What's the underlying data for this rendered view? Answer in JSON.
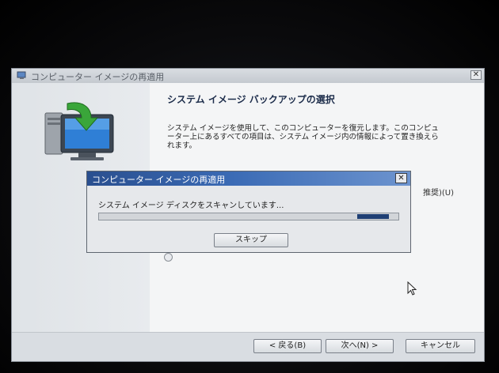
{
  "wizard": {
    "title": "コンピューター イメージの再適用",
    "close_glyph": "✕",
    "heading": "システム イメージ バックアップの選択",
    "description": "システム イメージを使用して、このコンピューターを復元します。このコンピューター上にあるすべての項目は、システム イメージ内の情報によって置き換えられます。",
    "hidden_option_text": "推奨)(U)",
    "buttons": {
      "back": "< 戻る(B)",
      "next": "次へ(N) >",
      "cancel": "キャンセル"
    }
  },
  "dialog": {
    "title": "コンピューター イメージの再適用",
    "close_glyph": "✕",
    "status": "システム イメージ ディスクをスキャンしています...",
    "progress_mode": "marquee",
    "skip_button": "スキップ"
  },
  "colors": {
    "dialog_title_accent": "#2a4f8f",
    "progress_fill": "#1f3f74"
  },
  "icons": {
    "wizard_title": "restore-computer-icon",
    "hero": "computer-restore-icon",
    "cursor": "mouse-pointer-icon"
  }
}
